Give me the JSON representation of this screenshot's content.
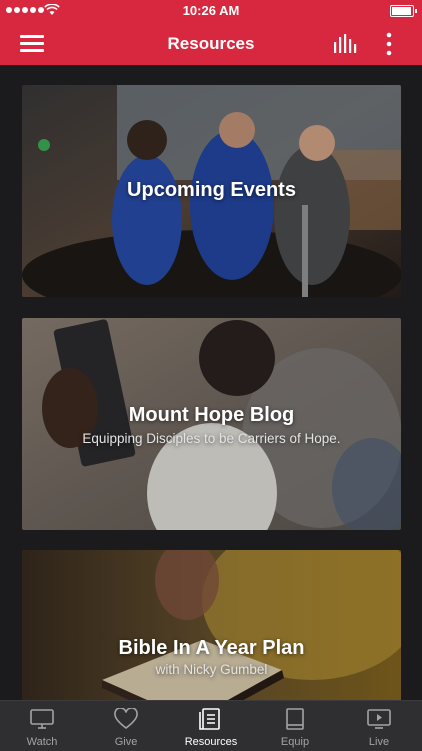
{
  "status_bar": {
    "time": "10:26 AM"
  },
  "nav": {
    "title": "Resources",
    "menu_icon": "hamburger-menu-icon",
    "audio_icon": "audio-bars-icon",
    "more_icon": "more-vertical-icon"
  },
  "cards": [
    {
      "title": "Upcoming Events",
      "subtitle": "",
      "image": "baptism-photo"
    },
    {
      "title": "Mount Hope Blog",
      "subtitle": "Equipping Disciples to be Carriers of Hope.",
      "image": "person-holding-bible-photo"
    },
    {
      "title": "Bible In A Year Plan",
      "subtitle": "with Nicky Gumbel",
      "image": "open-bible-photo"
    }
  ],
  "tabs": [
    {
      "label": "Watch",
      "icon": "tv-icon",
      "active": false
    },
    {
      "label": "Give",
      "icon": "heart-icon",
      "active": false
    },
    {
      "label": "Resources",
      "icon": "document-list-icon",
      "active": true
    },
    {
      "label": "Equip",
      "icon": "book-icon",
      "active": false
    },
    {
      "label": "Live",
      "icon": "play-screen-icon",
      "active": false
    }
  ],
  "colors": {
    "brand_red": "#d8283f",
    "background": "#1b1b1d",
    "tabbar": "#2f2f31",
    "tab_inactive": "#a3a3a6",
    "tab_active": "#ffffff"
  }
}
